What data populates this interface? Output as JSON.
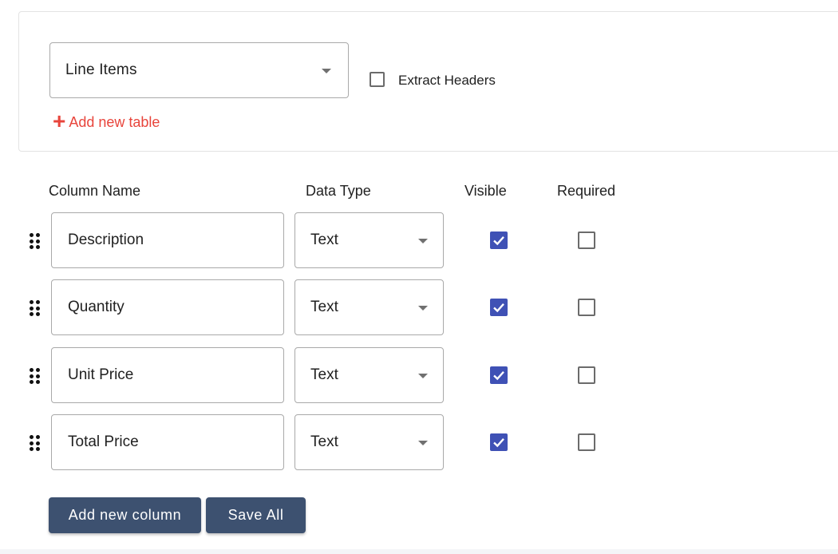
{
  "table_card": {
    "table_select_value": "Line Items",
    "extract_headers_label": "Extract Headers",
    "extract_headers_checked": false,
    "add_table_label": "Add new table"
  },
  "columns_header": {
    "name": "Column Name",
    "type": "Data Type",
    "visible": "Visible",
    "required": "Required"
  },
  "rows": [
    {
      "name": "Description",
      "type": "Text",
      "visible": true,
      "required": false
    },
    {
      "name": "Quantity",
      "type": "Text",
      "visible": true,
      "required": false
    },
    {
      "name": "Unit Price",
      "type": "Text",
      "visible": true,
      "required": false
    },
    {
      "name": "Total Price",
      "type": "Text",
      "visible": true,
      "required": false
    }
  ],
  "buttons": {
    "add_column": "Add new column",
    "save_all": "Save All"
  },
  "colors": {
    "accent_red": "#e8453c",
    "checkbox_blue": "#3f51b5",
    "button_navy": "#3d5170"
  },
  "icons": {
    "drag": "drag-handle-icon",
    "dropdown": "chevron-down-icon",
    "add": "plus-icon",
    "check": "check-icon"
  }
}
